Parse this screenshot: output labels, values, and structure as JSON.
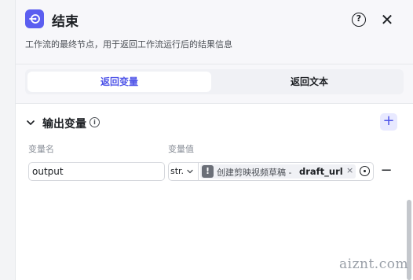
{
  "header": {
    "title": "结束",
    "description": "工作流的最终节点，用于返回工作流运行后的结果信息",
    "help_label": "?",
    "close_label": "✕",
    "logo_icon": "exit-node-icon",
    "accent_color": "#5b5ef0"
  },
  "tabs": [
    {
      "label": "返回变量",
      "active": true
    },
    {
      "label": "返回文本",
      "active": false
    }
  ],
  "output_section": {
    "title": "输出变量",
    "info_label": "i",
    "add_label": "+",
    "columns": {
      "name": "变量名",
      "value": "变量值"
    },
    "rows": [
      {
        "name": "output",
        "type": "str.",
        "warning_label": "!",
        "ref_source": "创建剪映视频草稿 -",
        "ref_variable": "draft_url",
        "clear_label": "×",
        "remove_label": "−"
      }
    ]
  },
  "watermark": "aiznt.com"
}
